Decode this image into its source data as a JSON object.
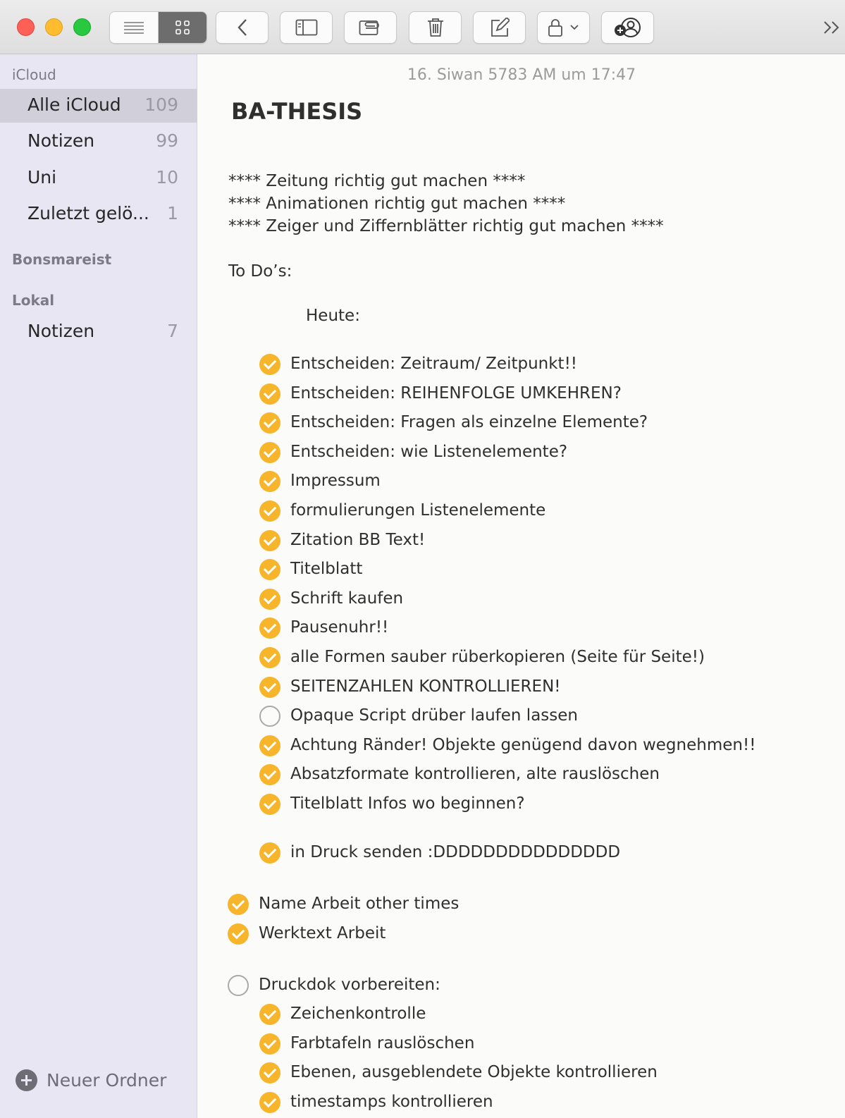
{
  "toolbar": {
    "buttons": [
      "list-view",
      "gallery-view",
      "back",
      "show-sidebar",
      "attachments",
      "delete",
      "compose",
      "lock",
      "collaborate"
    ]
  },
  "sidebar": {
    "groups": [
      {
        "title": "iCloud"
      },
      {
        "title": "Bonsmareist"
      },
      {
        "title": "Lokal"
      }
    ],
    "icloud_items": [
      {
        "label": "Alle iCloud",
        "count": "109"
      },
      {
        "label": "Notizen",
        "count": "99"
      },
      {
        "label": "Uni",
        "count": "10"
      },
      {
        "label": "Zuletzt gelö...",
        "count": "1"
      }
    ],
    "lokal_items": [
      {
        "label": "Notizen",
        "count": "7"
      }
    ],
    "new_folder_label": "Neuer Ordner"
  },
  "note": {
    "date": "16. Siwan 5783 AM um 17:47",
    "title": "BA-THESIS",
    "intro_lines": [
      "**** Zeitung richtig gut machen ****",
      "**** Animationen richtig gut machen ****",
      "**** Zeiger und Ziffernblätter richtig gut machen ****"
    ],
    "todo_heading": "To Do’s:",
    "today_heading": "Heute:",
    "today_items": [
      {
        "text": "Entscheiden: Zeitraum/  Zeitpunkt!!",
        "done": true
      },
      {
        "text": "Entscheiden: REIHENFOLGE UMKEHREN?",
        "done": true
      },
      {
        "text": "Entscheiden: Fragen als einzelne Elemente?",
        "done": true
      },
      {
        "text": "Entscheiden: wie Listenelemente?",
        "done": true
      },
      {
        "text": "Impressum",
        "done": true
      },
      {
        "text": "formulierungen Listenelemente",
        "done": true
      },
      {
        "text": "Zitation BB Text!",
        "done": true
      },
      {
        "text": "Titelblatt",
        "done": true
      },
      {
        "text": "Schrift kaufen",
        "done": true
      },
      {
        "text": "Pausenuhr!!",
        "done": true
      },
      {
        "text": "alle Formen sauber rüberkopieren (Seite für Seite!)",
        "done": true
      },
      {
        "text": "SEITENZAHLEN KONTROLLIEREN!",
        "done": true
      },
      {
        "text": "Opaque Script drüber laufen lassen",
        "done": false
      },
      {
        "text": "Achtung Ränder! Objekte genügend davon wegnehmen!!",
        "done": true
      },
      {
        "text": "Absatzformate kontrollieren, alte rauslöschen",
        "done": true
      },
      {
        "text": "Titelblatt Infos wo beginnen?",
        "done": true
      }
    ],
    "print_item": {
      "text": "in Druck senden :DDDDDDDDDDDDDDD",
      "done": true
    },
    "top_items": [
      {
        "text": "Name Arbeit other times",
        "done": true
      },
      {
        "text": "Werktext Arbeit",
        "done": true
      }
    ],
    "druck_item": {
      "text": "Druckdok vorbereiten:",
      "done": false
    },
    "druck_subitems": [
      {
        "text": "Zeichenkontrolle",
        "done": true
      },
      {
        "text": "Farbtafeln rauslöschen",
        "done": true
      },
      {
        "text": "Ebenen, ausgeblendete Objekte kontrollieren",
        "done": true
      },
      {
        "text": "timestamps kontrollieren",
        "done": true
      }
    ]
  },
  "colors": {
    "check": "#f7b52c",
    "sidebar_bg": "#e8e6f2",
    "selection": "#d1cfda"
  }
}
